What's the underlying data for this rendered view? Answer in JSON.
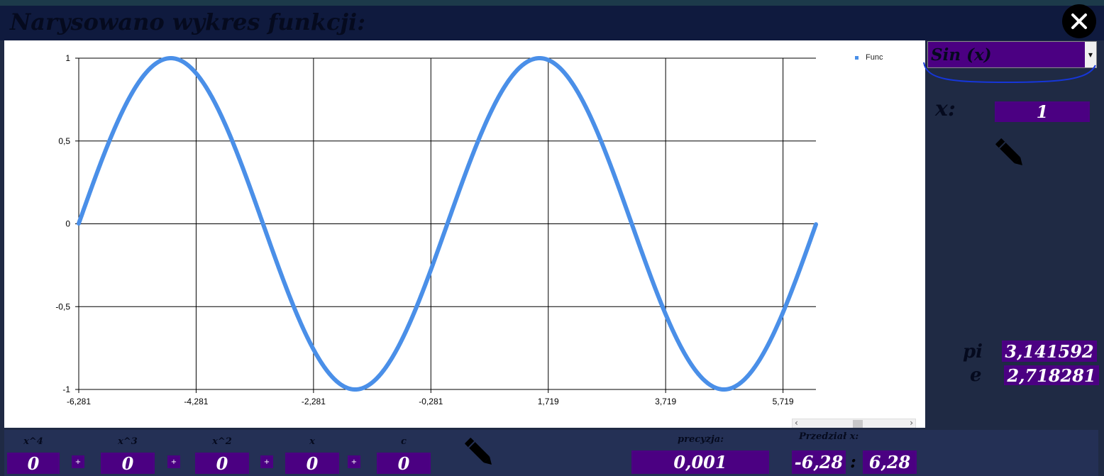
{
  "window": {
    "title": "Narysowano wykres funkcji:"
  },
  "legend": {
    "label": "Func"
  },
  "function_select": {
    "selected": "Sin (x)"
  },
  "x_input": {
    "label": "x:",
    "value": "1"
  },
  "constants": {
    "pi_label": "pi",
    "pi_value": "3,141592",
    "e_label": "e",
    "e_value": "2,718281"
  },
  "polynomial": {
    "terms": [
      {
        "label": "x^4",
        "value": "0"
      },
      {
        "label": "x^3",
        "value": "0"
      },
      {
        "label": "x^2",
        "value": "0"
      },
      {
        "label": "x",
        "value": "0"
      },
      {
        "label": "c",
        "value": "0"
      }
    ],
    "plus_label": "+"
  },
  "precision": {
    "label": "precyzja:",
    "value": "0,001"
  },
  "range": {
    "label": "Przedział x:",
    "from": "-6,28",
    "separator": ":",
    "to": "6,28"
  },
  "colors": {
    "purple": "#4b0082",
    "navy": "#1f2a44",
    "line": "#4a8fe8"
  },
  "chart_data": {
    "type": "line",
    "function": "sin(x)",
    "series": [
      {
        "name": "Func"
      }
    ],
    "x_range": [
      -6.281,
      6.28
    ],
    "ylim": [
      -1,
      1
    ],
    "x_ticks": [
      "-6,281",
      "-4,281",
      "-2,281",
      "-0,281",
      "1,719",
      "3,719",
      "5,719"
    ],
    "y_ticks": [
      "1",
      "0,5",
      "0",
      "-0,5",
      "-1"
    ],
    "grid": true,
    "legend_position": "top-right"
  }
}
